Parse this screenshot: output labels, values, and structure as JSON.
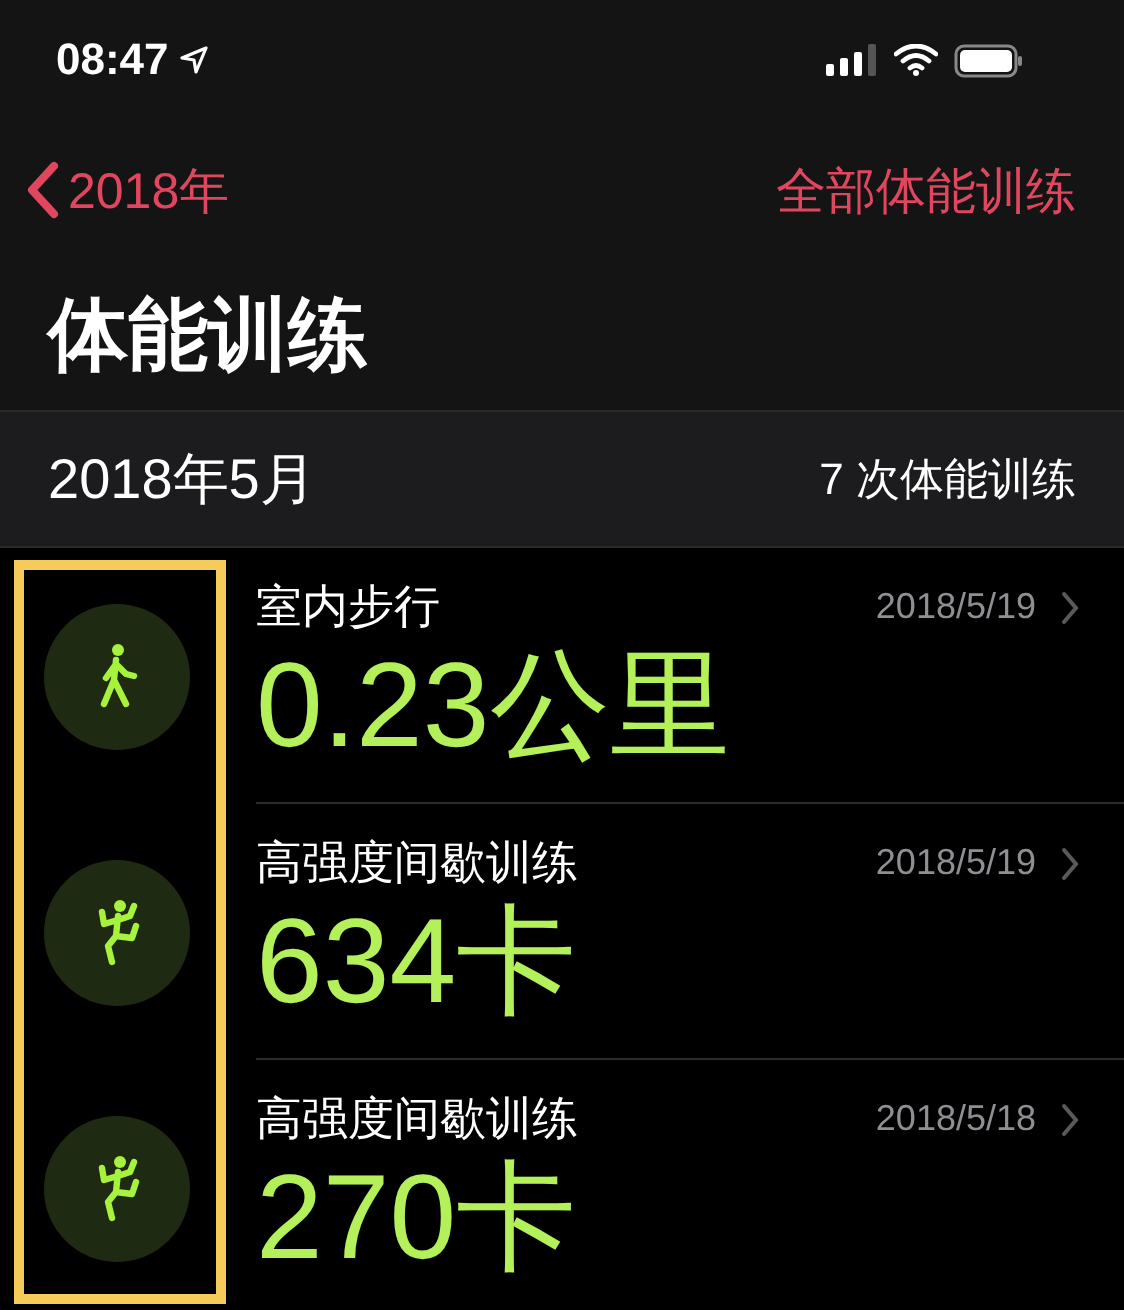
{
  "status_bar": {
    "time": "08:47"
  },
  "nav": {
    "back": "2018年",
    "action": "全部体能训练"
  },
  "title": "体能训练",
  "section": {
    "month": "2018年5月",
    "count": "7 次体能训练"
  },
  "workouts": [
    {
      "kind": "walk",
      "name": "室内步行",
      "value": "0.23公里",
      "date": "2018/5/19"
    },
    {
      "kind": "hiit",
      "name": "高强度间歇训练",
      "value": "634卡",
      "date": "2018/5/19"
    },
    {
      "kind": "hiit",
      "name": "高强度间歇训练",
      "value": "270卡",
      "date": "2018/5/18"
    }
  ]
}
